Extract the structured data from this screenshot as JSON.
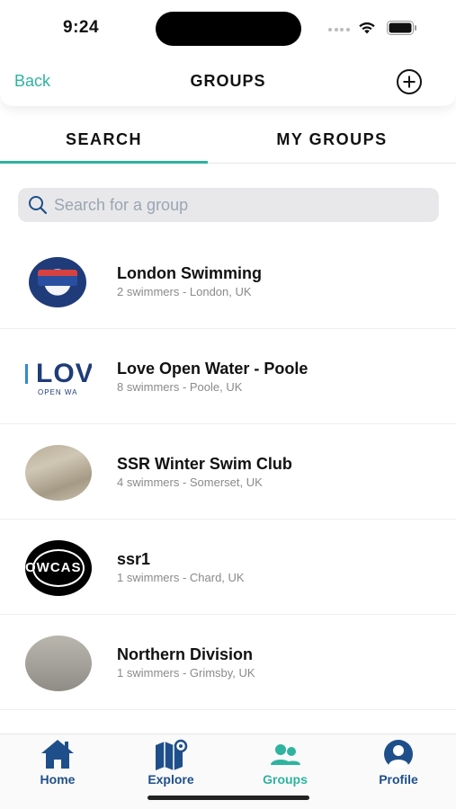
{
  "status_bar": {
    "time": "9:24"
  },
  "header": {
    "back_label": "Back",
    "title": "GROUPS"
  },
  "tabs": [
    {
      "label": "SEARCH",
      "active": true
    },
    {
      "label": "MY GROUPS",
      "active": false
    }
  ],
  "search": {
    "placeholder": "Search for a group"
  },
  "groups": [
    {
      "name": "London Swimming",
      "meta": "2 swimmers - London, UK",
      "avatar": "london-swimmers-logo"
    },
    {
      "name": "Love Open Water - Poole",
      "meta": "8 swimmers - Poole, UK",
      "avatar": "love-open-water-logo",
      "avatar_text": "LOV",
      "avatar_subtext": "OPEN WA"
    },
    {
      "name": "SSR Winter Swim Club",
      "meta": "4 swimmers - Somerset, UK",
      "avatar": "sand-photo"
    },
    {
      "name": "ssr1",
      "meta": "1 swimmers - Chard, UK",
      "avatar": "lowcast-logo",
      "avatar_text": "OWCAS"
    },
    {
      "name": "Northern Division",
      "meta": "1 swimmers - Grimsby, UK",
      "avatar": "grey-photo"
    }
  ],
  "tab_bar": {
    "items": [
      {
        "label": "Home",
        "icon": "home-icon",
        "active": false
      },
      {
        "label": "Explore",
        "icon": "map-icon",
        "active": false
      },
      {
        "label": "Groups",
        "icon": "groups-icon",
        "active": true
      },
      {
        "label": "Profile",
        "icon": "profile-icon",
        "active": false
      }
    ]
  },
  "colors": {
    "accent": "#2eb39f",
    "nav_inactive": "#1f4f8a",
    "search_bg": "#e8e8ea",
    "meta_text": "#8a8a8a"
  }
}
